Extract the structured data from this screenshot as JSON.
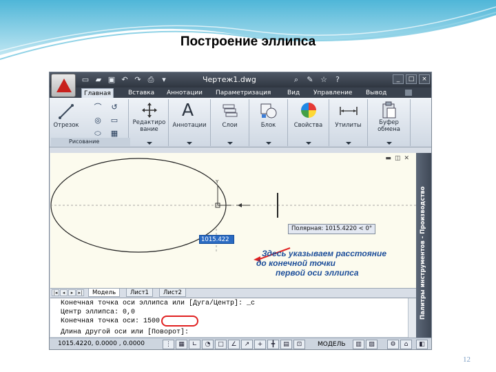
{
  "slide": {
    "title": "Построение эллипса",
    "page_number": "12"
  },
  "app": {
    "document_title": "Чертеж1.dwg",
    "tabs": [
      "Главная",
      "Вставка",
      "Аннотации",
      "Параметризация",
      "Вид",
      "Управление",
      "Вывод"
    ],
    "active_tab": "Главная",
    "ribbon": {
      "draw_panel": {
        "line_label": "Отрезок",
        "footer_label": "Рисование"
      },
      "modify_label": "Редактиро\nвание",
      "annotation_label": "Аннотации",
      "layers_label": "Слои",
      "block_label": "Блок",
      "properties_label": "Свойства",
      "utilities_label": "Утилиты",
      "clipboard_label": "Буфер\nобмена"
    },
    "drawing": {
      "coord_input_value": "1015.422",
      "polar_tooltip": "Полярная: 1015.4220 < 0°",
      "axis_y_label": "Y",
      "annotation_lines": [
        "Здесь указываем расстояние",
        "до конечной точки",
        "первой оси эллипса"
      ],
      "ellipse": {
        "center_x": 0,
        "center_y": 0,
        "first_axis_endpoint": 1500
      }
    },
    "sidebar_label": "Палитры инструментов - Производство",
    "layout_tabs": [
      "Модель",
      "Лист1",
      "Лист2"
    ],
    "active_layout_tab": "Модель",
    "command_lines": [
      "Конечная точка оси эллипса или [Дуга/Центр]: _c",
      "Центр эллипса: 0,0",
      "Конечная точка оси: 1500",
      "Длина другой оси или [Поворот]:"
    ],
    "highlighted_value": "1500",
    "status": {
      "coordinates": "1015.4220, 0.0000 , 0.0000",
      "model_label": "МОДЕЛЬ"
    },
    "colors": {
      "accent_red": "#e02020",
      "annotation_blue": "#1e4f9a",
      "dynamic_input_blue": "#2a6ac2"
    }
  }
}
